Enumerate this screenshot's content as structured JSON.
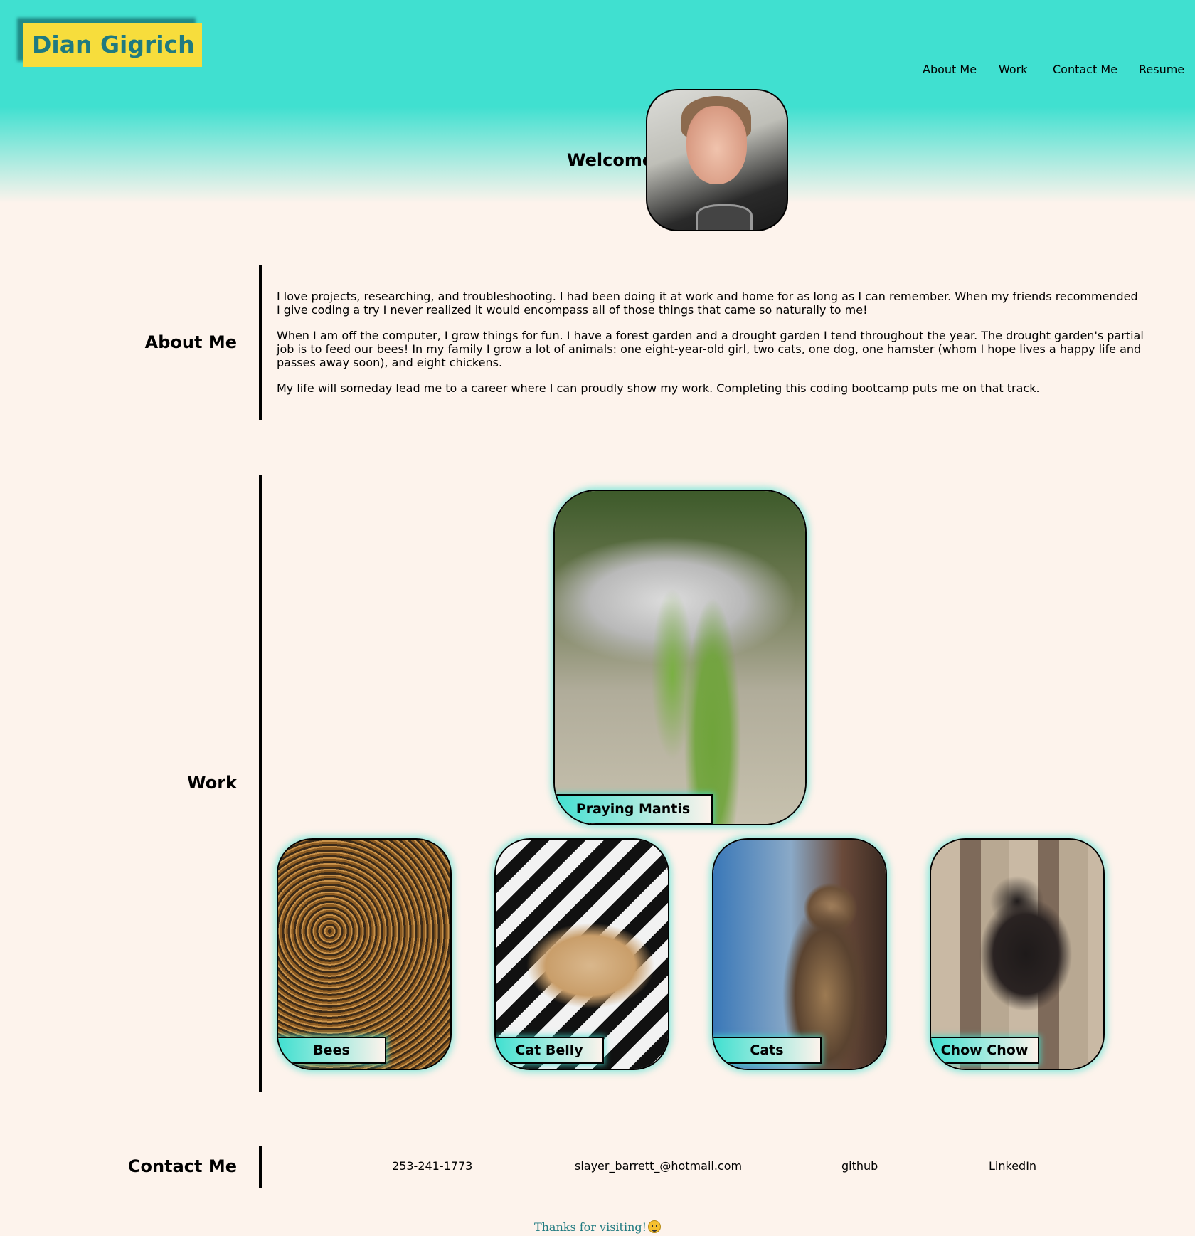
{
  "header": {
    "logo": "Dian Gigrich",
    "nav": [
      "About Me",
      "Work",
      "Contact Me",
      "Resume"
    ],
    "welcome": "Welcome!"
  },
  "about": {
    "title": "About Me",
    "paragraphs": [
      "I love projects, researching, and troubleshooting. I had been doing it at work and home for as long as I can remember. When my friends recommended I give coding a try I never realized it would encompass all of those things that came so naturally to me!",
      "When I am off the computer, I grow things for fun. I have a forest garden and a drought garden I tend throughout the year. The drought garden's partial job is to feed our bees! In my family I grow a lot of animals: one eight-year-old girl, two cats, one dog, one hamster (whom I hope lives a happy life and passes away soon), and eight chickens.",
      "My life will someday lead me to a career where I can proudly show my work. Completing this coding bootcamp puts me on that track."
    ]
  },
  "work": {
    "title": "Work",
    "featured": "Praying Mantis",
    "items": [
      "Bees",
      "Cat Belly",
      "Cats",
      "Chow Chow"
    ]
  },
  "contact": {
    "title": "Contact Me",
    "phone": "253-241-1773",
    "email": "slayer_barrett_@hotmail.com",
    "github": "github",
    "linkedin": "LinkedIn"
  },
  "footer": {
    "text": "Thanks for visiting!",
    "icon": "smiley-icon"
  },
  "colors": {
    "accent": "#40e0d0",
    "logo_bg": "#f7dd3c",
    "logo_text": "#1f7a80",
    "page_bg": "#fdf3ec"
  }
}
